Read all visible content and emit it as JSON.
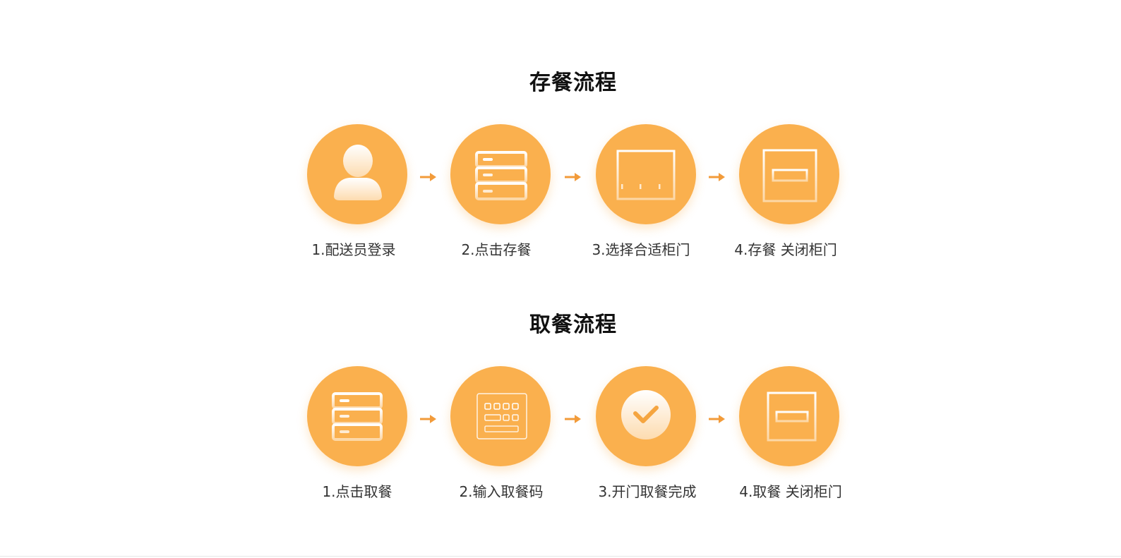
{
  "colors": {
    "accent": "#FAB04E",
    "arrow": "#F29B3A",
    "title": "#111111",
    "label": "#333333"
  },
  "store_flow": {
    "title": "存餐流程",
    "steps": [
      {
        "label": "1.配送员登录",
        "icon": "person-icon"
      },
      {
        "label": "2.点击存餐",
        "icon": "drawer-stack-icon"
      },
      {
        "label": "3.选择合适柜门",
        "icon": "locker-doors-icon"
      },
      {
        "label": "4.存餐 关闭柜门",
        "icon": "closed-door-icon"
      }
    ]
  },
  "pickup_flow": {
    "title": "取餐流程",
    "steps": [
      {
        "label": "1.点击取餐",
        "icon": "drawer-stack-icon"
      },
      {
        "label": "2.输入取餐码",
        "icon": "keypad-icon"
      },
      {
        "label": "3.开门取餐完成",
        "icon": "check-circle-icon"
      },
      {
        "label": "4.取餐 关闭柜门",
        "icon": "closed-door-icon"
      }
    ]
  }
}
